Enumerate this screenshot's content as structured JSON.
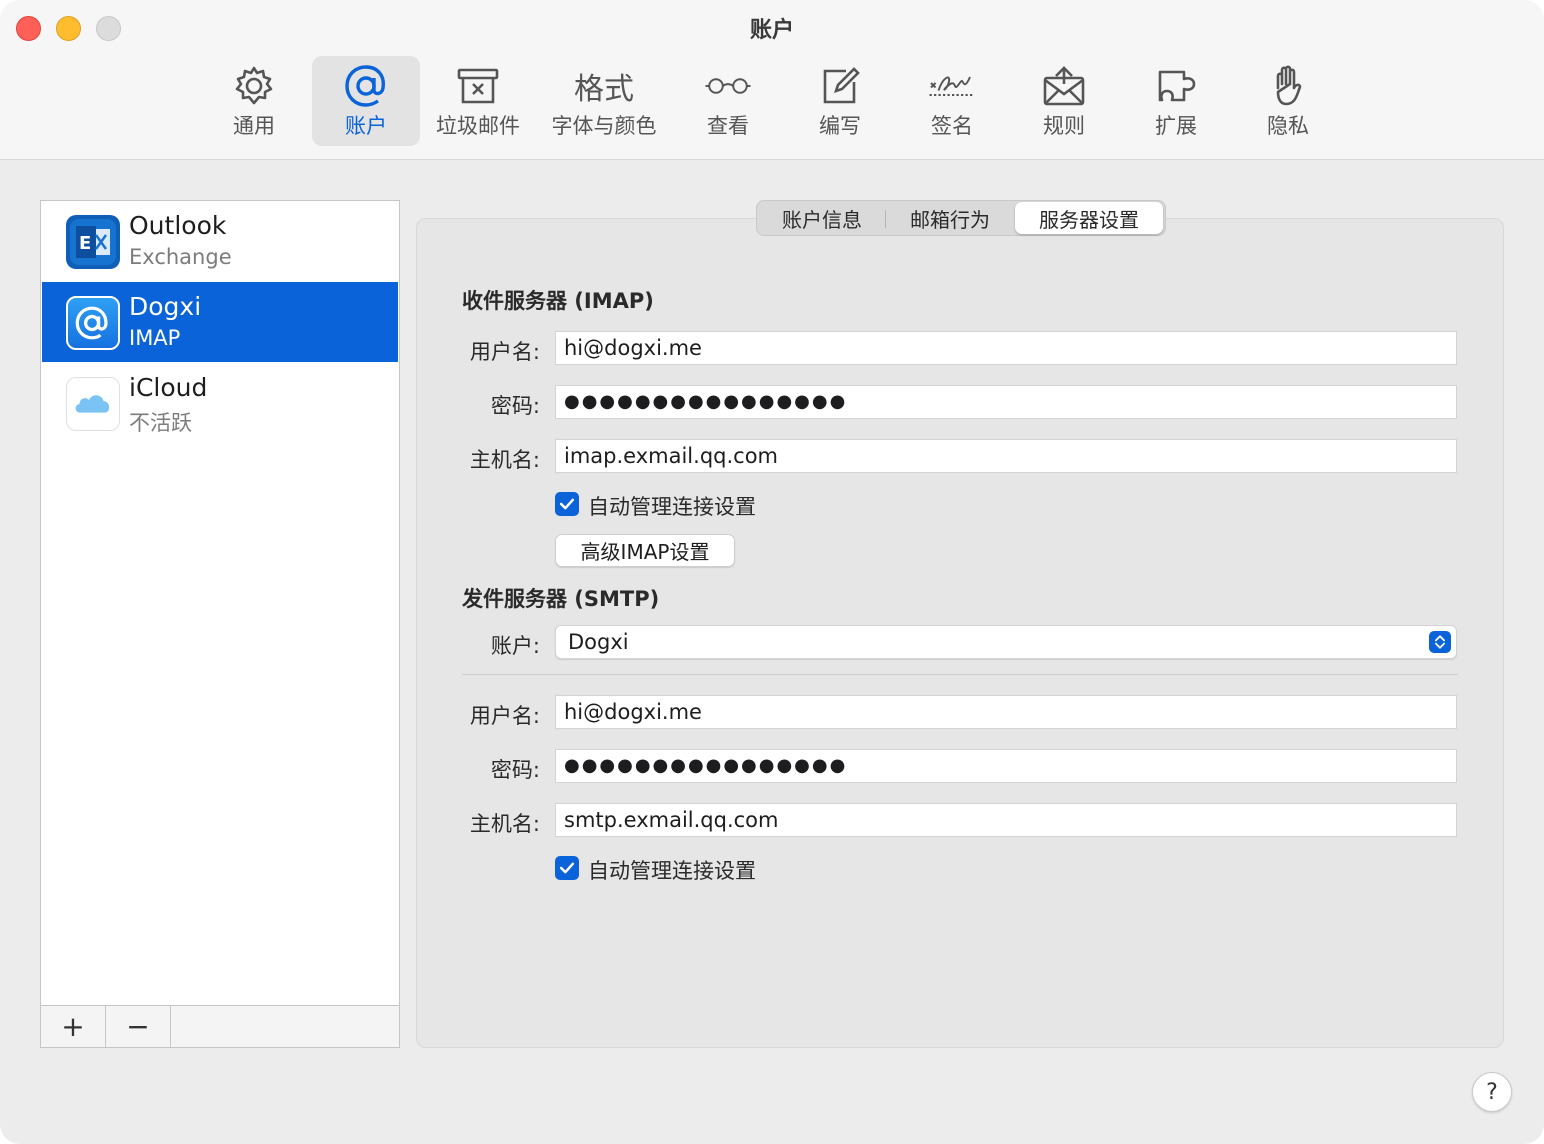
{
  "window": {
    "title": "账户"
  },
  "toolbar": {
    "items": [
      {
        "label": "通用",
        "icon": "gear-icon"
      },
      {
        "label": "账户",
        "icon": "at-icon"
      },
      {
        "label": "垃圾邮件",
        "icon": "junk-tray-icon"
      },
      {
        "label": "字体与颜色",
        "icon": "format-text-icon",
        "icon_text": "格式"
      },
      {
        "label": "查看",
        "icon": "glasses-icon"
      },
      {
        "label": "编写",
        "icon": "compose-icon"
      },
      {
        "label": "签名",
        "icon": "signature-icon"
      },
      {
        "label": "规则",
        "icon": "rules-envelope-icon"
      },
      {
        "label": "扩展",
        "icon": "puzzle-icon"
      },
      {
        "label": "隐私",
        "icon": "hand-icon"
      }
    ],
    "active": "账户"
  },
  "accounts": {
    "items": [
      {
        "name": "Outlook",
        "sub": "Exchange",
        "icon": "exchange-icon"
      },
      {
        "name": "Dogxi",
        "sub": "IMAP",
        "icon": "at-mail-icon"
      },
      {
        "name": "iCloud",
        "sub": "不活跃",
        "icon": "icloud-icon"
      }
    ],
    "selected": "Dogxi",
    "add_label": "+",
    "remove_label": "−"
  },
  "tabs": {
    "items": [
      "账户信息",
      "邮箱行为",
      "服务器设置"
    ],
    "active": "服务器设置"
  },
  "incoming": {
    "title": "收件服务器 (IMAP)",
    "username_label": "用户名:",
    "username": "hi@dogxi.me",
    "password_label": "密码:",
    "password": "●●●●●●●●●●●●●●●●",
    "host_label": "主机名:",
    "host": "imap.exmail.qq.com",
    "auto_manage_label": "自动管理连接设置",
    "auto_manage": true,
    "advanced_button": "高级IMAP设置"
  },
  "outgoing": {
    "title": "发件服务器 (SMTP)",
    "account_label": "账户:",
    "account": "Dogxi",
    "username_label": "用户名:",
    "username": "hi@dogxi.me",
    "password_label": "密码:",
    "password": "●●●●●●●●●●●●●●●●",
    "host_label": "主机名:",
    "host": "smtp.exmail.qq.com",
    "auto_manage_label": "自动管理连接设置",
    "auto_manage": true
  },
  "help_label": "?",
  "colors": {
    "accent": "#0a63d8",
    "close": "#fe5f57",
    "minimize": "#febc2e"
  }
}
